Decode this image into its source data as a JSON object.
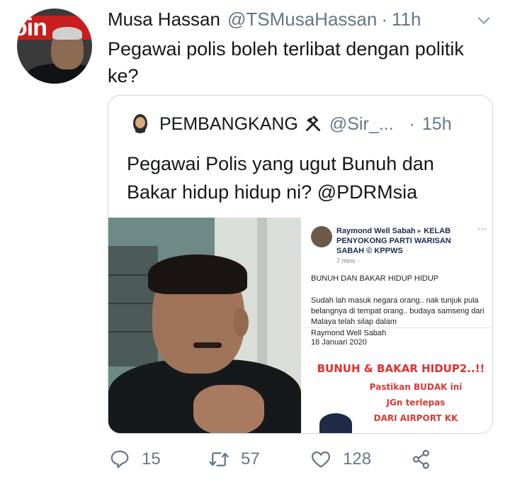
{
  "tweet": {
    "author_name": "Musa Hassan",
    "author_handle": "@TSMusaHassan",
    "separator": "·",
    "time": "11h",
    "avatar_banner_text": "oin",
    "text": "Pegawai polis boleh terlibat dengan politik ke?"
  },
  "quoted_tweet": {
    "author_name": "PEMBANGKANG",
    "author_handle": "@Sir_...",
    "separator": "·",
    "time": "15h",
    "text": "Pegawai Polis yang ugut Bunuh dan Bakar hidup hidup ni? @PDRMsia",
    "facebook_post": {
      "poster": "Raymond Well Sabah",
      "arrow": "▸",
      "group": "KELAB PENYOKONG PARTI WARISAN SABAH",
      "group_abbrev": "KPPWS",
      "meta": "7 mins ·",
      "ellipsis": "···",
      "headline": "BUNUH DAN BAKAR HIDUP HIDUP",
      "body": "Sudah lah masuk negara orang.. nak tunjuk pula belangnya di tempat orang.. budaya samseng dari Malaya telah silap dalam",
      "signature_name": "Raymond Well Sabah",
      "signature_date": "18 Januari 2020",
      "banner_title": "BUNUH & BAKAR HIDUP2..!!",
      "banner_lines": [
        "Pastikan BUDAK ini",
        "JGn terlepas",
        "DARI AIRPORT KK"
      ]
    }
  },
  "actions": {
    "reply_count": "15",
    "retweet_count": "57",
    "like_count": "128"
  },
  "colors": {
    "text": "#14171a",
    "secondary": "#657786",
    "border": "#ccd6dd",
    "banner_red": "#e0302f"
  },
  "icons": [
    "chevron-down-icon",
    "reply-icon",
    "retweet-icon",
    "like-icon",
    "share-icon",
    "hammer-pick-icon"
  ]
}
